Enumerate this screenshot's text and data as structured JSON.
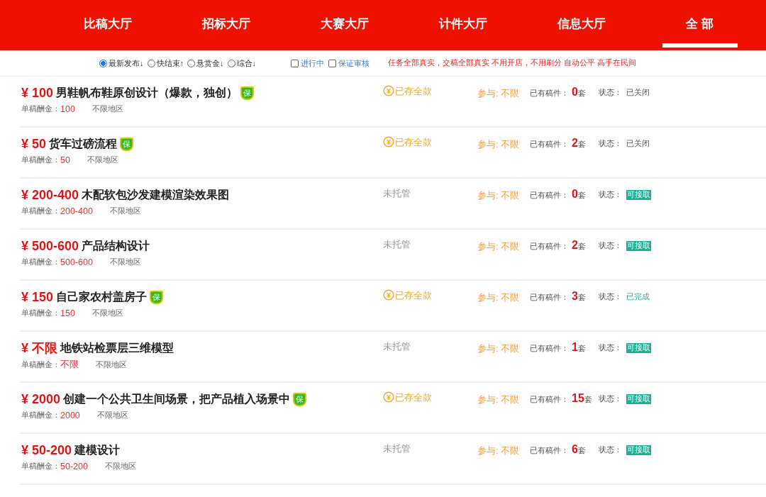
{
  "nav": [
    {
      "label": "比稿大厅",
      "selected": false
    },
    {
      "label": "招标大厅",
      "selected": false
    },
    {
      "label": "大赛大厅",
      "selected": false
    },
    {
      "label": "计件大厅",
      "selected": false
    },
    {
      "label": "信息大厅",
      "selected": false
    },
    {
      "label": "全 部",
      "selected": true
    }
  ],
  "sort_options": [
    {
      "label": "最新发布↓",
      "selected": true
    },
    {
      "label": "快结束↑",
      "selected": false
    },
    {
      "label": "悬赏金↓",
      "selected": false
    },
    {
      "label": "综合↓",
      "selected": false
    }
  ],
  "filters": [
    {
      "label": "进行中",
      "checked": false
    },
    {
      "label": "保证审核",
      "checked": false
    }
  ],
  "slogan": "任务全部真实，交稿全部真实 不用开店，不用刷分 自动公平 高手在民间",
  "tasks": [
    {
      "price": "¥ 100",
      "title": "男鞋帆布鞋原创设计（爆款，独创）",
      "badge": "保",
      "fee_label": "单稿酬金：",
      "fee": "100",
      "region": "不限地区",
      "escrow": "已存全款",
      "paid": true,
      "participate": "参与: 不限",
      "count_label": "已有稿件：",
      "count": "0",
      "count_unit": "套",
      "status_label": "状态：",
      "status": {
        "kind": "closed",
        "text": "已关闭"
      }
    },
    {
      "price": "¥ 50",
      "title": "货车过磅流程",
      "badge": "保",
      "fee_label": "单稿酬金：",
      "fee": "50",
      "region": "不限地区",
      "escrow": "已存全款",
      "paid": true,
      "participate": "参与: 不限",
      "count_label": "已有稿件：",
      "count": "2",
      "count_unit": "套",
      "status_label": "状态：",
      "status": {
        "kind": "closed",
        "text": "已关闭"
      }
    },
    {
      "price": "¥ 200-400",
      "title": "木配软包沙发建模渲染效果图",
      "fee_label": "单稿酬金：",
      "fee": "200-400",
      "region": "不限地区",
      "escrow": "未托管",
      "paid": false,
      "participate": "参与: 不限",
      "count_label": "已有稿件：",
      "count": "0",
      "count_unit": "套",
      "status_label": "状态：",
      "status": {
        "kind": "open",
        "text": "可接取"
      }
    },
    {
      "price": "¥ 500-600",
      "title": "产品结构设计",
      "fee_label": "单稿酬金：",
      "fee": "500-600",
      "region": "不限地区",
      "escrow": "未托管",
      "paid": false,
      "participate": "参与: 不限",
      "count_label": "已有稿件：",
      "count": "2",
      "count_unit": "套",
      "status_label": "状态：",
      "status": {
        "kind": "open",
        "text": "可接取"
      }
    },
    {
      "price": "¥ 150",
      "title": "自己家农村盖房子",
      "badge": "保",
      "fee_label": "单稿酬金：",
      "fee": "150",
      "region": "不限地区",
      "escrow": "已存全款",
      "paid": true,
      "participate": "参与: 不限",
      "count_label": "已有稿件：",
      "count": "3",
      "count_unit": "套",
      "status_label": "状态：",
      "status": {
        "kind": "done",
        "text": "已完成"
      }
    },
    {
      "price": "¥ 不限",
      "title": "地铁站检票层三维模型",
      "fee_label": "单稿酬金：",
      "fee": "不限",
      "region": "不限地区",
      "escrow": "未托管",
      "paid": false,
      "participate": "参与: 不限",
      "count_label": "已有稿件：",
      "count": "1",
      "count_unit": "套",
      "status_label": "状态：",
      "status": {
        "kind": "open",
        "text": "可接取"
      }
    },
    {
      "price": "¥ 2000",
      "title": "创建一个公共卫生间场景，把产品植入场景中",
      "badge": "保",
      "fee_label": "单稿酬金：",
      "fee": "2000",
      "region": "不限地区",
      "escrow": "已存全款",
      "paid": true,
      "participate": "参与: 不限",
      "count_label": "已有稿件：",
      "count": "15",
      "count_unit": "套",
      "status_label": "状态：",
      "status": {
        "kind": "open",
        "text": "可接取"
      }
    },
    {
      "price": "¥ 50-200",
      "title": "建模设计",
      "fee_label": "单稿酬金：",
      "fee": "50-200",
      "region": "不限地区",
      "escrow": "未托管",
      "paid": false,
      "participate": "参与: 不限",
      "count_label": "已有稿件：",
      "count": "6",
      "count_unit": "套",
      "status_label": "状态：",
      "status": {
        "kind": "open",
        "text": "可接取"
      }
    }
  ]
}
